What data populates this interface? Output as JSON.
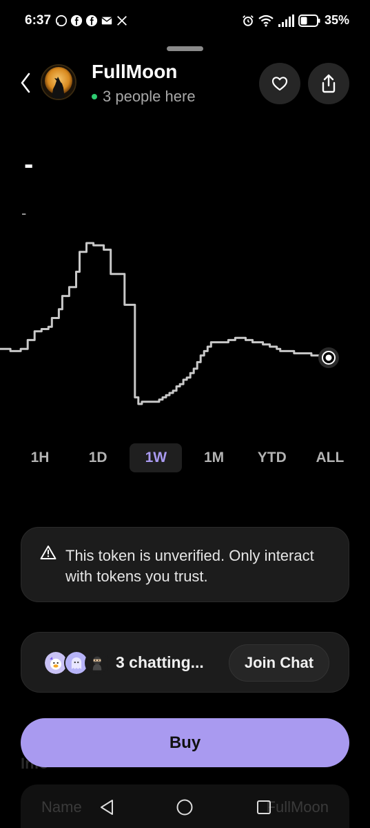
{
  "status_bar": {
    "time": "6:37",
    "battery": "35%",
    "left_icons": [
      "whatsapp-icon",
      "facebook-icon",
      "facebook-icon",
      "mail-icon",
      "x-icon"
    ],
    "right_icons": [
      "alarm-icon",
      "wifi-icon",
      "signal-icon",
      "battery-icon"
    ]
  },
  "header": {
    "token_name": "FullMoon",
    "presence": "3 people here",
    "presence_color": "#2ecc71",
    "icons": {
      "back": "chevron-left-icon",
      "favorite": "heart-icon",
      "share": "share-icon"
    }
  },
  "price": {
    "value": "-",
    "change": "-"
  },
  "chart": {
    "line_color": "#c8c8c8",
    "values": [
      52,
      52,
      52,
      51,
      51,
      51,
      52,
      52,
      56,
      56,
      60,
      60,
      61,
      61,
      62,
      66,
      66,
      70,
      76,
      76,
      80,
      80,
      87,
      96,
      96,
      100,
      100,
      99,
      99,
      99,
      97,
      97,
      86,
      86,
      86,
      86,
      72,
      72,
      72,
      30,
      27,
      28,
      28,
      28,
      28,
      28,
      29,
      30,
      31,
      32,
      33,
      35,
      36,
      38,
      39,
      41,
      43,
      46,
      49,
      51,
      53,
      55,
      55,
      55,
      55,
      55,
      56,
      56,
      57,
      57,
      57,
      56,
      56,
      55,
      55,
      55,
      54,
      54,
      53,
      53,
      52,
      51,
      51,
      51,
      51,
      50,
      50,
      50,
      50,
      50,
      49,
      49,
      49,
      49,
      48,
      48
    ]
  },
  "tabs": [
    {
      "label": "1H",
      "active": false
    },
    {
      "label": "1D",
      "active": false
    },
    {
      "label": "1W",
      "active": true
    },
    {
      "label": "1M",
      "active": false
    },
    {
      "label": "YTD",
      "active": false
    },
    {
      "label": "ALL",
      "active": false
    }
  ],
  "active_tab_color": "#a99af0",
  "warning": {
    "text": "This token is unverified. Only interact with tokens you trust.",
    "icon": "warning-triangle-icon"
  },
  "chat": {
    "count_text": "3 chatting...",
    "join_label": "Join Chat"
  },
  "buy": {
    "label": "Buy",
    "color": "#a99af0"
  },
  "below_fold": {
    "section_partial": "Info",
    "name_label": "Name",
    "name_value": "FullMoon"
  },
  "nav_bar": {
    "icons": [
      "back-triangle-icon",
      "home-circle-icon",
      "recents-square-icon"
    ]
  }
}
